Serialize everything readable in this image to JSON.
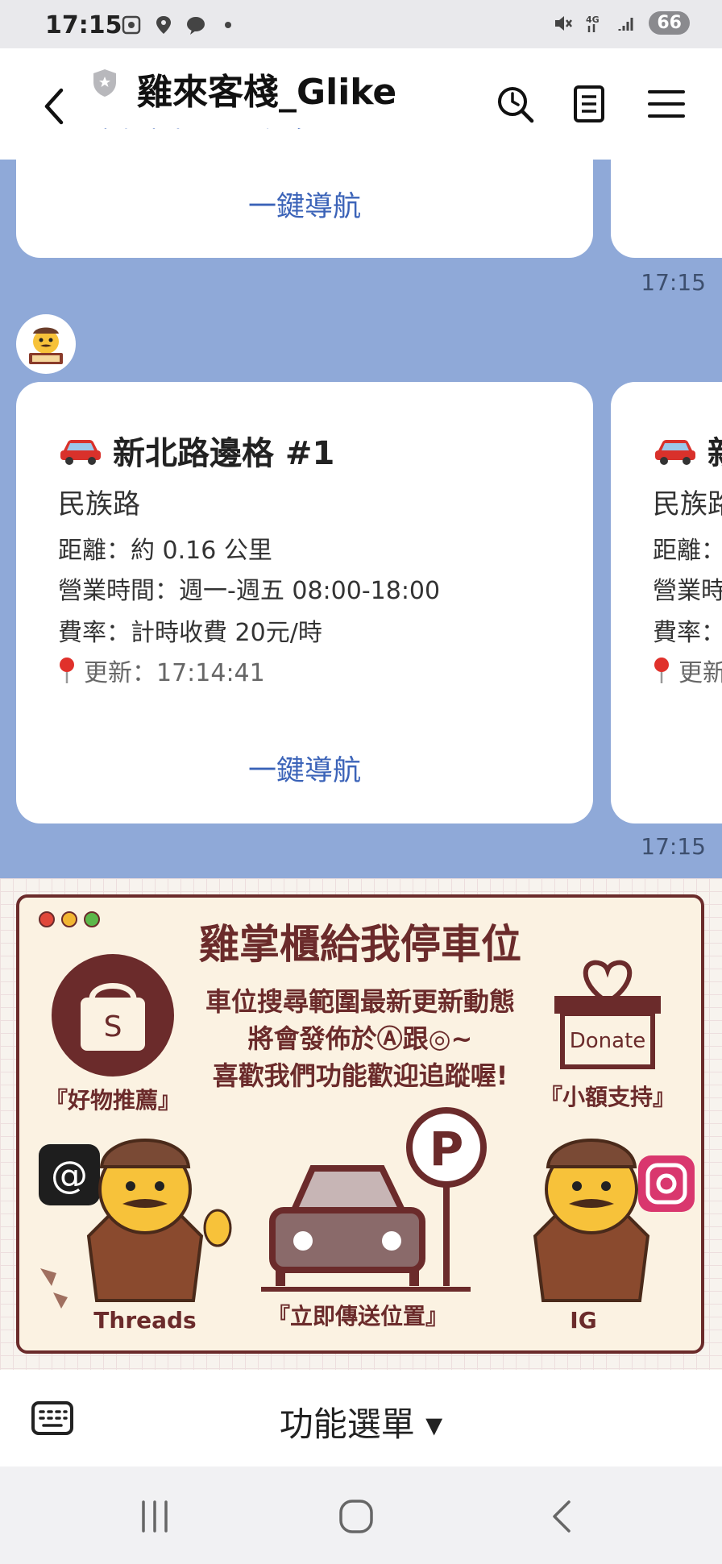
{
  "status": {
    "time": "17:15",
    "battery": "66",
    "network": "4G"
  },
  "header": {
    "title": "雞來客棧_Glike",
    "subtitle": "由負責人員回覆訊息"
  },
  "messages": [
    {
      "nav_label": "一鍵導航",
      "time": "17:15"
    },
    {
      "title": "新北路邊格 #1",
      "street": "民族路",
      "distance": "距離：約 0.16 公里",
      "hours": "營業時間：週一-週五 08:00-18:00",
      "rate": "費率：計時收費 20元/時",
      "updated": "更新：17:14:41",
      "nav_label": "一鍵導航",
      "time": "17:15"
    }
  ],
  "peek_card": {
    "title": "新",
    "street": "民族路",
    "distance": "距離：",
    "hours": "營業時",
    "rate": "費率：",
    "updated": "更新"
  },
  "rich_menu": {
    "title": "雞掌櫃給我停車位",
    "line1": "車位搜尋範圍最新更新動態",
    "line2": "將會發佈於Ⓐ跟◎~",
    "line3": "喜歡我們功能歡迎追蹤喔!",
    "shop_label": "『好物推薦』",
    "donate_word": "Donate",
    "donate_label": "『小額支持』",
    "threads_label": "Threads",
    "send_location_label": "『立即傳送位置』",
    "ig_label": "IG",
    "shop_letter": "S",
    "parking_letter": "P"
  },
  "bottom": {
    "menu_label": "功能選單 ▾"
  },
  "colors": {
    "chat_bg": "#8fa9d8",
    "link": "#3b63b8",
    "brand": "#6b2b2b"
  }
}
